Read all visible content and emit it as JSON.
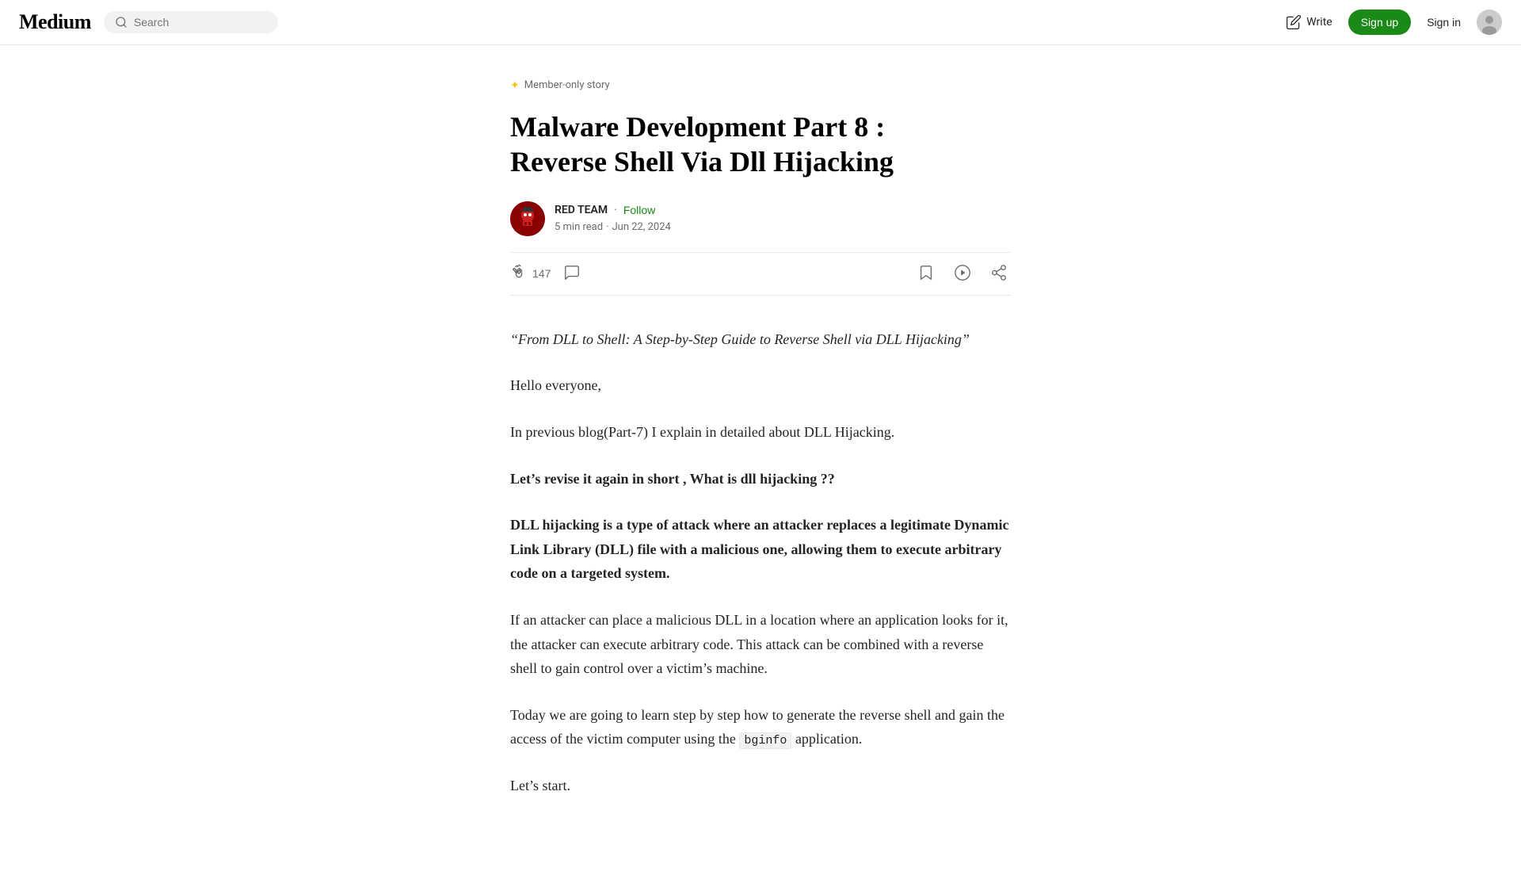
{
  "header": {
    "logo": "Medium",
    "search_placeholder": "Search",
    "write_label": "Write",
    "signup_label": "Sign up",
    "signin_label": "Sign in"
  },
  "article": {
    "member_badge": "Member-only story",
    "title_line1": "Malware Development Part 8 :",
    "title_line2": "Reverse Shell Via Dll Hijacking",
    "author_name": "RED TEAM",
    "follow_label": "Follow",
    "read_time": "5 min read",
    "date": "Jun 22, 2024",
    "clap_count": "147",
    "paragraphs": {
      "p1": "“From DLL to Shell: A Step-by-Step Guide to Reverse Shell via DLL Hijacking”",
      "p2": "Hello everyone,",
      "p3": "In previous blog(Part-7) I explain in detailed about DLL Hijacking.",
      "p4": "Let’s revise it again in short , What is dll hijacking ??",
      "p5": "DLL hijacking is a type of attack where an attacker replaces a legitimate Dynamic Link Library (DLL) file with a malicious one, allowing them to execute arbitrary code on a targeted system.",
      "p6": "If an attacker can place a malicious DLL in a location where an application looks for it, the attacker can execute arbitrary code. This attack can be combined with a reverse shell to gain control over a victim’s machine.",
      "p7_before_code": "Today we are going to learn step by step how to generate the reverse shell and gain the access of the victim computer using the",
      "p7_code": "bginfo",
      "p7_after_code": "application.",
      "p8": "Let’s start."
    }
  }
}
